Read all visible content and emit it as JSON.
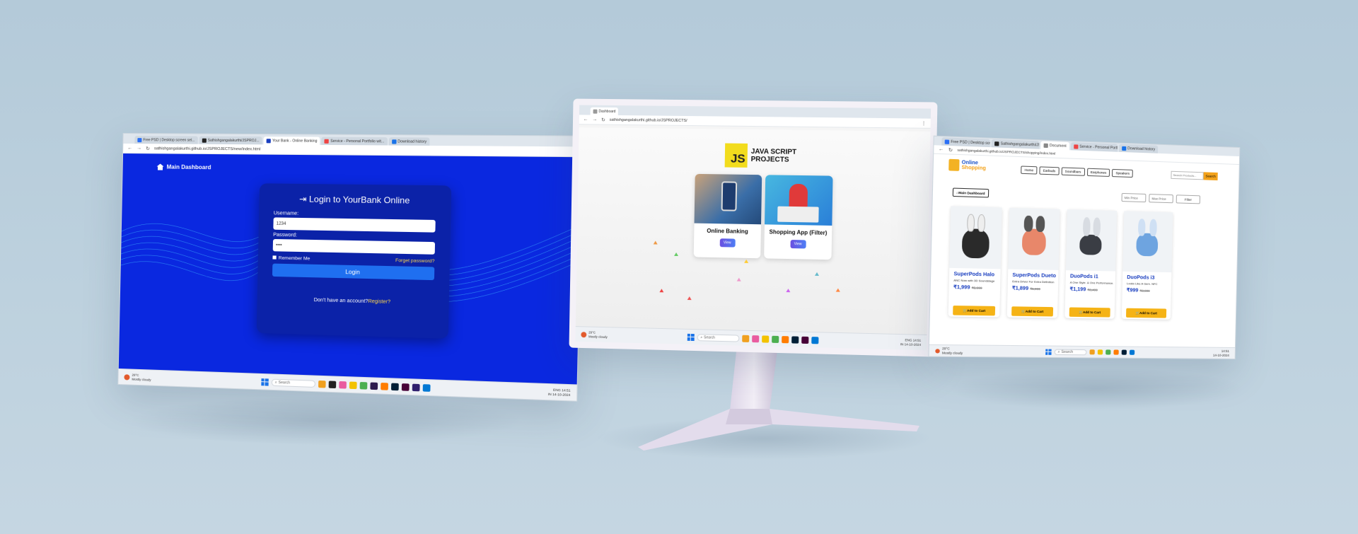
{
  "left_screen": {
    "tabs": [
      "Free PSD | Desktop screen sel...",
      "Sathishgangalakurthi/JSPROJ...",
      "Your Bank - Online Banking",
      "Service - Personal Portfolio wit...",
      "Download history"
    ],
    "url": "sathishgangalakurthi.github.io/JSPROJECTS/new/index.html",
    "main_dashboard": "Main Dashboard",
    "login_title": "Login to YourBank Online",
    "username_label": "Username:",
    "username_value": "1234",
    "password_label": "Password:",
    "password_value": "••••",
    "remember_me": "Remember Me",
    "forget_password": "Forget password?",
    "login_button": "Login",
    "no_account": "Don't have an account?",
    "register": "Register?",
    "taskbar": {
      "temp": "29°C",
      "weather": "Mostly cloudy",
      "search": "Search",
      "lang": "ENG",
      "region": "IN",
      "time": "14:51",
      "date": "14-10-2024"
    }
  },
  "center_screen": {
    "tab": "Dashboard",
    "url": "sathishgangalakurthi.github.io/JSPROJECTS/",
    "js_badge": "JS",
    "title_line1": "JAVA SCRIPT",
    "title_line2": "PROJECTS",
    "cards": [
      {
        "title": "Online Banking",
        "button": "View"
      },
      {
        "title": "Shopping App (Filter)",
        "button": "View"
      }
    ],
    "taskbar": {
      "temp": "29°C",
      "weather": "Mostly cloudy",
      "search": "Search",
      "lang": "ENG",
      "region": "IN",
      "time": "14:51",
      "date": "14-10-2024"
    }
  },
  "right_screen": {
    "tabs": [
      "Free PSD | Desktop screen sel...",
      "Sathishgangalakurthi/JSPROJ...",
      "Document",
      "Service - Personal Portfolio wit...",
      "Download history"
    ],
    "url": "sathishgangalakurthi.github.io/JSPROJECTS/shopping/index.html",
    "logo_line1": "Online",
    "logo_line2": "Shopping",
    "nav": [
      "Home",
      "Earbuds",
      "Soundbars",
      "Earphones",
      "Speakers"
    ],
    "search_placeholder": "Search Products...",
    "search_button": "Search",
    "main_dashboard": "Main Dashboard",
    "min_price": "Min Price",
    "max_price": "Max Price",
    "filter_button": "Filter",
    "products": [
      {
        "name": "SuperPods Halo",
        "desc": "ANC Now with 3D Soundstage",
        "price": "₹1,999",
        "old": "₹5,999",
        "cta": "Add to Cart",
        "color": "#2a2a2a"
      },
      {
        "name": "SuperPods Dueto",
        "desc": "Extra Driver For Extra Definition",
        "price": "₹1,899",
        "old": "₹5,999",
        "cta": "Add to Cart",
        "color": "#e8876a"
      },
      {
        "name": "DuoPods i1",
        "desc": "A One Style. & One Performance.",
        "price": "₹1,199",
        "old": "₹3,499",
        "cta": "Add to Cart",
        "color": "#3a3d44"
      },
      {
        "name": "DuoPods i3",
        "desc": "Looks Like A Gem. NFC",
        "price": "₹999",
        "old": "₹3,999",
        "cta": "Add to Cart",
        "color": "#6ea4e0"
      }
    ],
    "taskbar": {
      "temp": "29°C",
      "weather": "Mostly cloudy",
      "search": "Search",
      "time": "14:51",
      "date": "14-10-2024"
    }
  },
  "colors": {
    "bank_blue": "#0a28e0",
    "card_blue": "#0b22a8",
    "link_yellow": "#ffd84a",
    "js_yellow": "#f2dc1d",
    "cart_yellow": "#f5b316"
  }
}
